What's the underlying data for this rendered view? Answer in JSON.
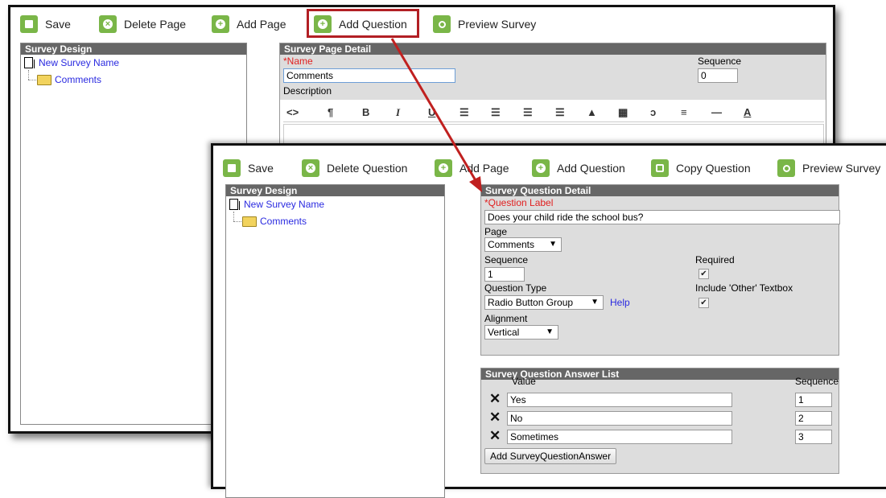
{
  "back_window": {
    "toolbar": {
      "save": "Save",
      "delete_page": "Delete Page",
      "add_page": "Add Page",
      "add_question": "Add Question",
      "preview_survey": "Preview Survey"
    },
    "design_panel": {
      "title": "Survey Design",
      "survey_name": "New Survey Name",
      "folder": "Comments"
    },
    "page_detail": {
      "title": "Survey Page Detail",
      "name_label": "*Name",
      "name_value": "Comments",
      "sequence_label": "Sequence",
      "sequence_value": "0",
      "description_label": "Description",
      "editor_icons": [
        "<>",
        "¶",
        "B",
        "I",
        "U",
        "☰",
        "☰",
        "☰",
        "☰",
        "▲",
        "▦",
        "ↄ",
        "≡",
        "—",
        "A"
      ]
    }
  },
  "front_window": {
    "toolbar": {
      "save": "Save",
      "delete_question": "Delete Question",
      "add_page": "Add Page",
      "add_question": "Add Question",
      "copy_question": "Copy Question",
      "preview_survey": "Preview Survey"
    },
    "design_panel": {
      "title": "Survey Design",
      "survey_name": "New Survey Name",
      "folder": "Comments"
    },
    "question_detail": {
      "title": "Survey Question Detail",
      "question_label": "*Question Label",
      "question_value": "Does your child ride the school bus?",
      "page_label": "Page",
      "page_value": "Comments",
      "sequence_label": "Sequence",
      "sequence_value": "1",
      "required_label": "Required",
      "required_checked": true,
      "question_type_label": "Question Type",
      "question_type_value": "Radio Button Group",
      "help_link": "Help",
      "include_other_label": "Include 'Other' Textbox",
      "include_other_checked": true,
      "alignment_label": "Alignment",
      "alignment_value": "Vertical"
    },
    "answer_list": {
      "title": "Survey Question Answer List",
      "value_header": "Value",
      "sequence_header": "Sequence",
      "rows": [
        {
          "value": "Yes",
          "sequence": "1"
        },
        {
          "value": "No",
          "sequence": "2"
        },
        {
          "value": "Sometimes",
          "sequence": "3"
        }
      ],
      "add_button": "Add SurveyQuestionAnswer"
    }
  },
  "colors": {
    "toolbar_icon": "#7ab648",
    "highlight": "#b21f24",
    "panel_header": "#666666",
    "link": "#2a2ae0",
    "required": "#e02020"
  }
}
